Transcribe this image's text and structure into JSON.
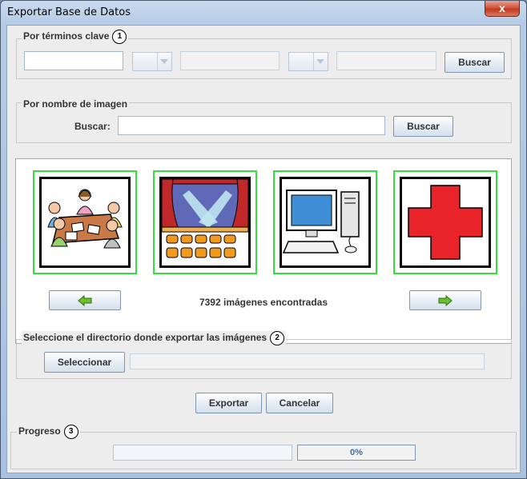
{
  "window": {
    "title": "Exportar Base de Datos",
    "close_glyph": "x"
  },
  "keywords": {
    "legend": "Por términos clave",
    "step": "1",
    "field1": "",
    "field2": "",
    "field3": "",
    "search_label": "Buscar"
  },
  "image_name": {
    "legend": "Por nombre de imagen",
    "label": "Buscar:",
    "value": "",
    "search_label": "Buscar"
  },
  "results": {
    "count_text": "7392 imágenes encontradas",
    "thumbnails": [
      "meeting-pictogram",
      "theater-pictogram",
      "computer-pictogram",
      "red-cross-pictogram"
    ],
    "highlight_color": "#33e03c"
  },
  "directory": {
    "legend": "Seleccione el directorio donde exportar las imágenes",
    "step": "2",
    "select_label": "Seleccionar",
    "path": ""
  },
  "actions": {
    "export_label": "Exportar",
    "cancel_label": "Cancelar"
  },
  "progress": {
    "legend": "Progreso",
    "step": "3",
    "value": 0,
    "percent_text": "0%"
  }
}
